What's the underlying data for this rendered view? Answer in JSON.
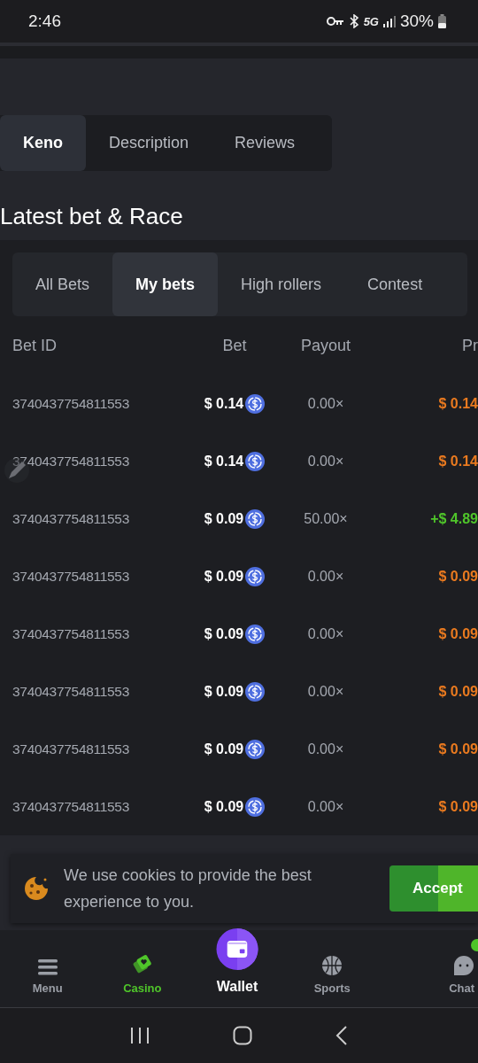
{
  "status_bar": {
    "time": "2:46",
    "network": "5G",
    "battery": "30%"
  },
  "game_tabs": [
    {
      "label": "Keno",
      "selected": true
    },
    {
      "label": "Description",
      "selected": false
    },
    {
      "label": "Reviews",
      "selected": false
    }
  ],
  "section_title": "Latest bet & Race",
  "bet_tabs": [
    {
      "label": "All Bets",
      "selected": false
    },
    {
      "label": "My bets",
      "selected": true
    },
    {
      "label": "High rollers",
      "selected": false
    },
    {
      "label": "Contest",
      "selected": false
    }
  ],
  "table": {
    "columns": [
      "Bet ID",
      "Bet",
      "Payout",
      "Pr"
    ],
    "rows": [
      {
        "bet_id": "3740437754811553",
        "bet": "$ 0.14",
        "payout": "0.00×",
        "profit": "$ 0.14",
        "kind": "loss"
      },
      {
        "bet_id": "3740437754811553",
        "bet": "$ 0.14",
        "payout": "0.00×",
        "profit": "$ 0.14",
        "kind": "loss"
      },
      {
        "bet_id": "3740437754811553",
        "bet": "$ 0.09",
        "payout": "50.00×",
        "profit": "+$ 4.89",
        "kind": "win"
      },
      {
        "bet_id": "3740437754811553",
        "bet": "$ 0.09",
        "payout": "0.00×",
        "profit": "$ 0.09",
        "kind": "loss"
      },
      {
        "bet_id": "3740437754811553",
        "bet": "$ 0.09",
        "payout": "0.00×",
        "profit": "$ 0.09",
        "kind": "loss"
      },
      {
        "bet_id": "3740437754811553",
        "bet": "$ 0.09",
        "payout": "0.00×",
        "profit": "$ 0.09",
        "kind": "loss"
      },
      {
        "bet_id": "3740437754811553",
        "bet": "$ 0.09",
        "payout": "0.00×",
        "profit": "$ 0.09",
        "kind": "loss"
      },
      {
        "bet_id": "3740437754811553",
        "bet": "$ 0.09",
        "payout": "0.00×",
        "profit": "$ 0.09",
        "kind": "loss"
      }
    ]
  },
  "cookie_banner": {
    "text": "We use cookies to provide the best experience to you.",
    "button": "Accept"
  },
  "bottom_nav": [
    {
      "label": "Menu",
      "kind": "menu",
      "selected": false
    },
    {
      "label": "Casino",
      "kind": "casino",
      "selected": true
    },
    {
      "label": "Wallet",
      "kind": "wallet",
      "selected": false
    },
    {
      "label": "Sports",
      "kind": "sports",
      "selected": false
    },
    {
      "label": "Chat",
      "kind": "chat",
      "selected": false
    }
  ]
}
